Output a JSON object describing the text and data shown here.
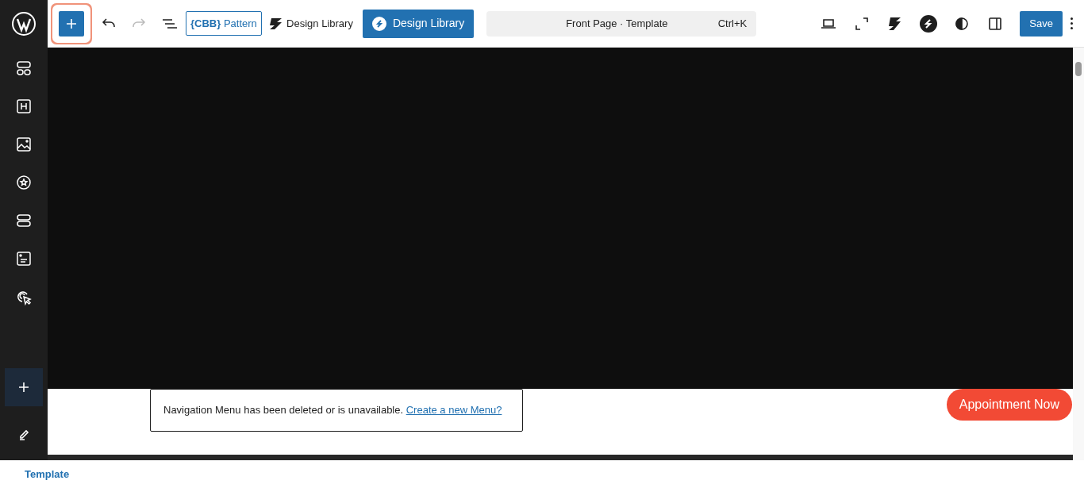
{
  "toolbar": {
    "inserter": {
      "highlighted": true
    },
    "history": [
      {
        "kind": "undo",
        "disabled": false
      },
      {
        "kind": "redo",
        "disabled": true
      }
    ],
    "pattern_button": {
      "prefix": "{CBB}",
      "label": "Pattern"
    },
    "library_link": {
      "label": "Design Library"
    },
    "library_button": {
      "label": "Design Library"
    },
    "command_bar": {
      "title": "Front Page · Template",
      "shortcut": "Ctrl+K"
    },
    "save_button": {
      "label": "Save"
    }
  },
  "sidebar": {
    "tools": [
      {
        "selected": true
      },
      {
        "selected": false
      }
    ]
  },
  "canvas": {
    "notice": {
      "text": "Navigation Menu has been deleted or is unavailable.",
      "link": "Create a new Menu?"
    },
    "cta": "Appointment Now"
  },
  "footer": {
    "breadcrumb": "Template"
  }
}
